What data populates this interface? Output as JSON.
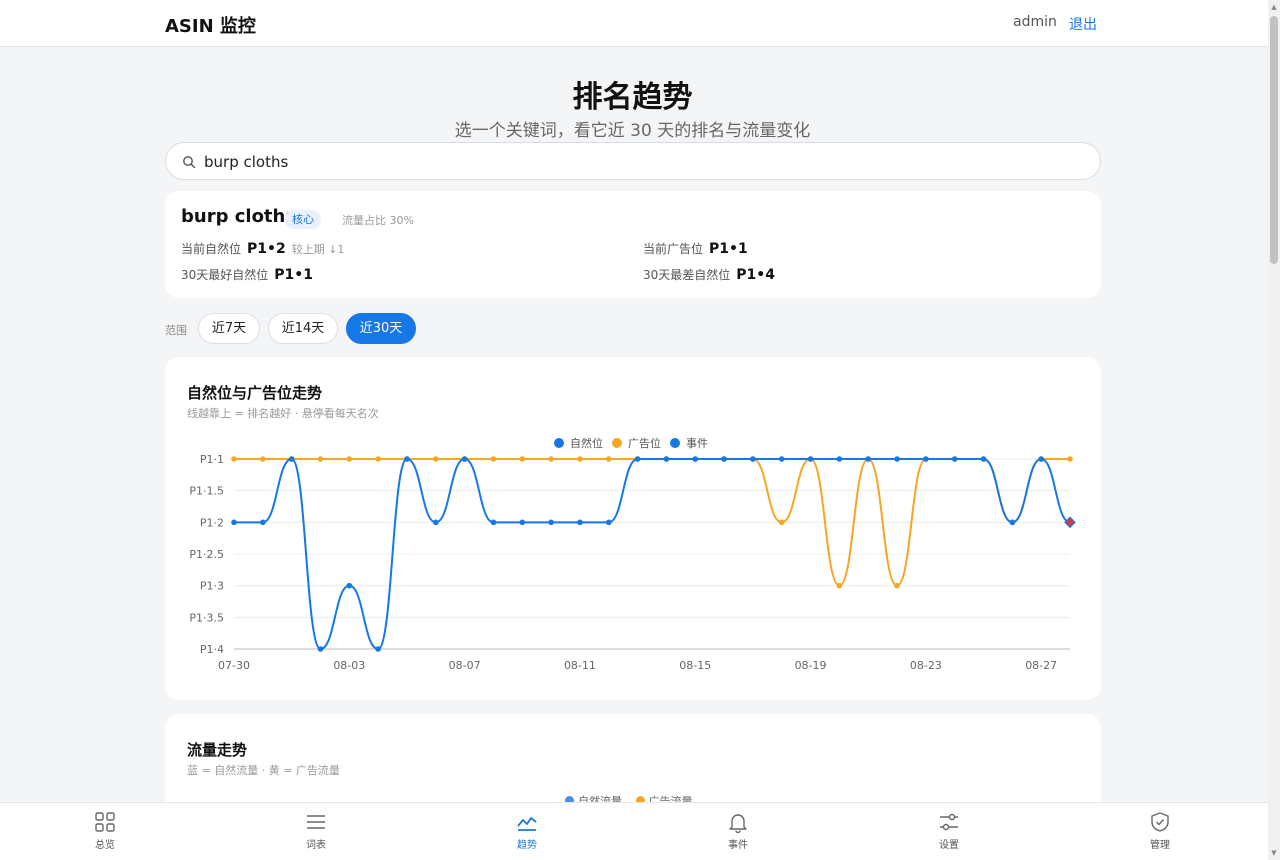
{
  "header": {
    "brand": "ASIN 监控",
    "user": "admin",
    "logout": "退出"
  },
  "page": {
    "title": "排名趋势",
    "subtitle": "选一个关键词，看它近 30 天的排名与流量变化"
  },
  "search": {
    "value": "burp cloths"
  },
  "keyword": {
    "name": "burp cloths",
    "badge": "核心",
    "share": "流量占比 30%",
    "current_organic_label": "当前自然位",
    "current_organic": "P1•2",
    "delta": "较上期 ↓1",
    "current_ad_label": "当前广告位",
    "current_ad": "P1•1",
    "best_label": "30天最好自然位",
    "best": "P1•1",
    "worst_label": "30天最差自然位",
    "worst": "P1•4"
  },
  "range": {
    "label": "范围",
    "options": [
      "近7天",
      "近14天",
      "近30天"
    ],
    "selected": "近30天"
  },
  "rank_chart": {
    "title": "自然位与广告位走势",
    "subtitle": "线越靠上 = 排名越好 · 悬停看每天名次"
  },
  "flow_chart": {
    "title": "流量走势",
    "subtitle": "蓝 = 自然流量 · 黄 = 广告流量",
    "legend": [
      "自然流量",
      "广告流量"
    ]
  },
  "colors": {
    "organic": "#1677e6",
    "ad": "#f5a623",
    "accent": "#1677e6"
  },
  "tabs": [
    {
      "label": "总览",
      "icon": "grid-icon"
    },
    {
      "label": "词表",
      "icon": "list-icon"
    },
    {
      "label": "趋势",
      "icon": "trend-icon",
      "active": true
    },
    {
      "label": "事件",
      "icon": "bell-icon"
    },
    {
      "label": "设置",
      "icon": "sliders-icon"
    },
    {
      "label": "管理",
      "icon": "shield-icon"
    }
  ],
  "chart_data": {
    "type": "line",
    "y_axis_reversed": true,
    "ylim": [
      1,
      4
    ],
    "yticks": [
      "P1·1",
      "P1·1.5",
      "P1·2",
      "P1·2.5",
      "P1·3",
      "P1·3.5",
      "P1·4"
    ],
    "xticks": [
      "07-30",
      "08-03",
      "08-07",
      "08-11",
      "08-15",
      "08-19",
      "08-23",
      "08-27"
    ],
    "x": [
      "07-30",
      "07-31",
      "08-01",
      "08-02",
      "08-03",
      "08-04",
      "08-05",
      "08-06",
      "08-07",
      "08-08",
      "08-09",
      "08-10",
      "08-11",
      "08-12",
      "08-13",
      "08-14",
      "08-15",
      "08-16",
      "08-17",
      "08-18",
      "08-19",
      "08-20",
      "08-21",
      "08-22",
      "08-23",
      "08-24",
      "08-25",
      "08-26",
      "08-27",
      "08-28"
    ],
    "legend": [
      "自然位",
      "广告位",
      "事件"
    ],
    "legend_position": "top-center",
    "series": [
      {
        "name": "自然位",
        "values": [
          2,
          2,
          1,
          4,
          3,
          4,
          1,
          2,
          1,
          2,
          2,
          2,
          2,
          2,
          1,
          1,
          1,
          1,
          1,
          1,
          1,
          1,
          1,
          1,
          1,
          1,
          1,
          2,
          1,
          2
        ]
      },
      {
        "name": "广告位",
        "values": [
          1,
          1,
          1,
          1,
          1,
          1,
          1,
          1,
          1,
          1,
          1,
          1,
          1,
          1,
          1,
          1,
          1,
          1,
          1,
          2,
          1,
          3,
          1,
          3,
          1,
          1,
          1,
          2,
          1,
          1
        ]
      }
    ],
    "events": [
      {
        "name": "事件",
        "x": "08-28",
        "y": 2
      }
    ]
  }
}
